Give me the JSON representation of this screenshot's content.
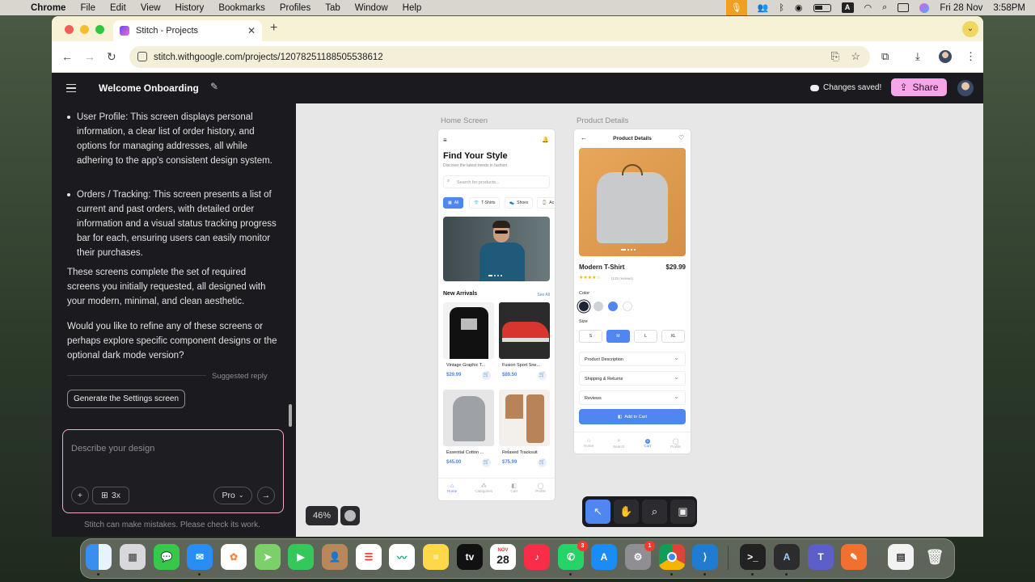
{
  "menubar": {
    "app": "Chrome",
    "items": [
      "File",
      "Edit",
      "View",
      "History",
      "Bookmarks",
      "Profiles",
      "Tab",
      "Window",
      "Help"
    ],
    "date": "Fri 28 Nov",
    "time": "3:58PM",
    "input_indicator": "A"
  },
  "browser": {
    "tab_title": "Stitch - Projects",
    "url": "stitch.withgoogle.com/projects/12078251188505538612"
  },
  "app": {
    "project_title": "Welcome Onboarding",
    "save_status": "Changes saved!",
    "share_label": "Share"
  },
  "chat": {
    "bullets": [
      "User Profile: This screen displays personal information, a clear list of order history, and options for managing addresses, all while adhering to the app's consistent design system.",
      "Orders / Tracking: This screen presents a list of current and past orders, with detailed order information and a visual status tracking progress bar for each, ensuring users can easily monitor their purchases."
    ],
    "paragraphs": [
      "These screens complete the set of required screens you initially requested, all designed with your modern, minimal, and clean aesthetic.",
      "Would you like to refine any of these screens or perhaps explore specific component designs or the optional dark mode version?"
    ],
    "suggested_label": "Suggested reply",
    "suggested_reply": "Generate the Settings screen",
    "composer_placeholder": "Describe your design",
    "variants_label": "3x",
    "model_label": "Pro",
    "disclaimer": "Stitch can make mistakes. Please check its work."
  },
  "canvas": {
    "zoom": "46%",
    "home": {
      "label": "Home Screen",
      "title": "Find Your Style",
      "subtitle": "Discover the latest trends in fashion.",
      "search_placeholder": "Search for products...",
      "chips": [
        "All",
        "T-Shirts",
        "Shoes",
        "Ac"
      ],
      "section": "New Arrivals",
      "see_all": "See All",
      "products": [
        {
          "name": "Vintage Graphic T...",
          "price": "$29.99"
        },
        {
          "name": "Fusion Sport Sne...",
          "price": "$89.50"
        },
        {
          "name": "Essential Cotton ...",
          "price": "$45.00"
        },
        {
          "name": "Relaxed Tracksuit",
          "price": "$75.99"
        }
      ],
      "nav": [
        "Home",
        "Categories",
        "Cart",
        "Profile"
      ]
    },
    "details": {
      "label": "Product Details",
      "header": "Product Details",
      "name": "Modern T-Shirt",
      "price": "$29.99",
      "stars": "★★★★☆",
      "reviews": "(125 reviews)",
      "color_label": "Color",
      "size_label": "Size",
      "sizes": [
        "S",
        "M",
        "L",
        "XL"
      ],
      "accordions": [
        "Product Description",
        "Shipping & Returns",
        "Reviews"
      ],
      "cta": "Add to Cart",
      "cart_count": "3",
      "nav": [
        "Home",
        "Search",
        "Cart",
        "Profile"
      ]
    }
  },
  "dock": {
    "calendar_month": "NOV",
    "calendar_day": "28",
    "appletv": "tv",
    "whatsapp_badge": "3",
    "settings_badge": "1"
  },
  "colors": {
    "accent": "#4f86f0",
    "share": "#f6a6e8",
    "dark": "#1b1b1f"
  }
}
